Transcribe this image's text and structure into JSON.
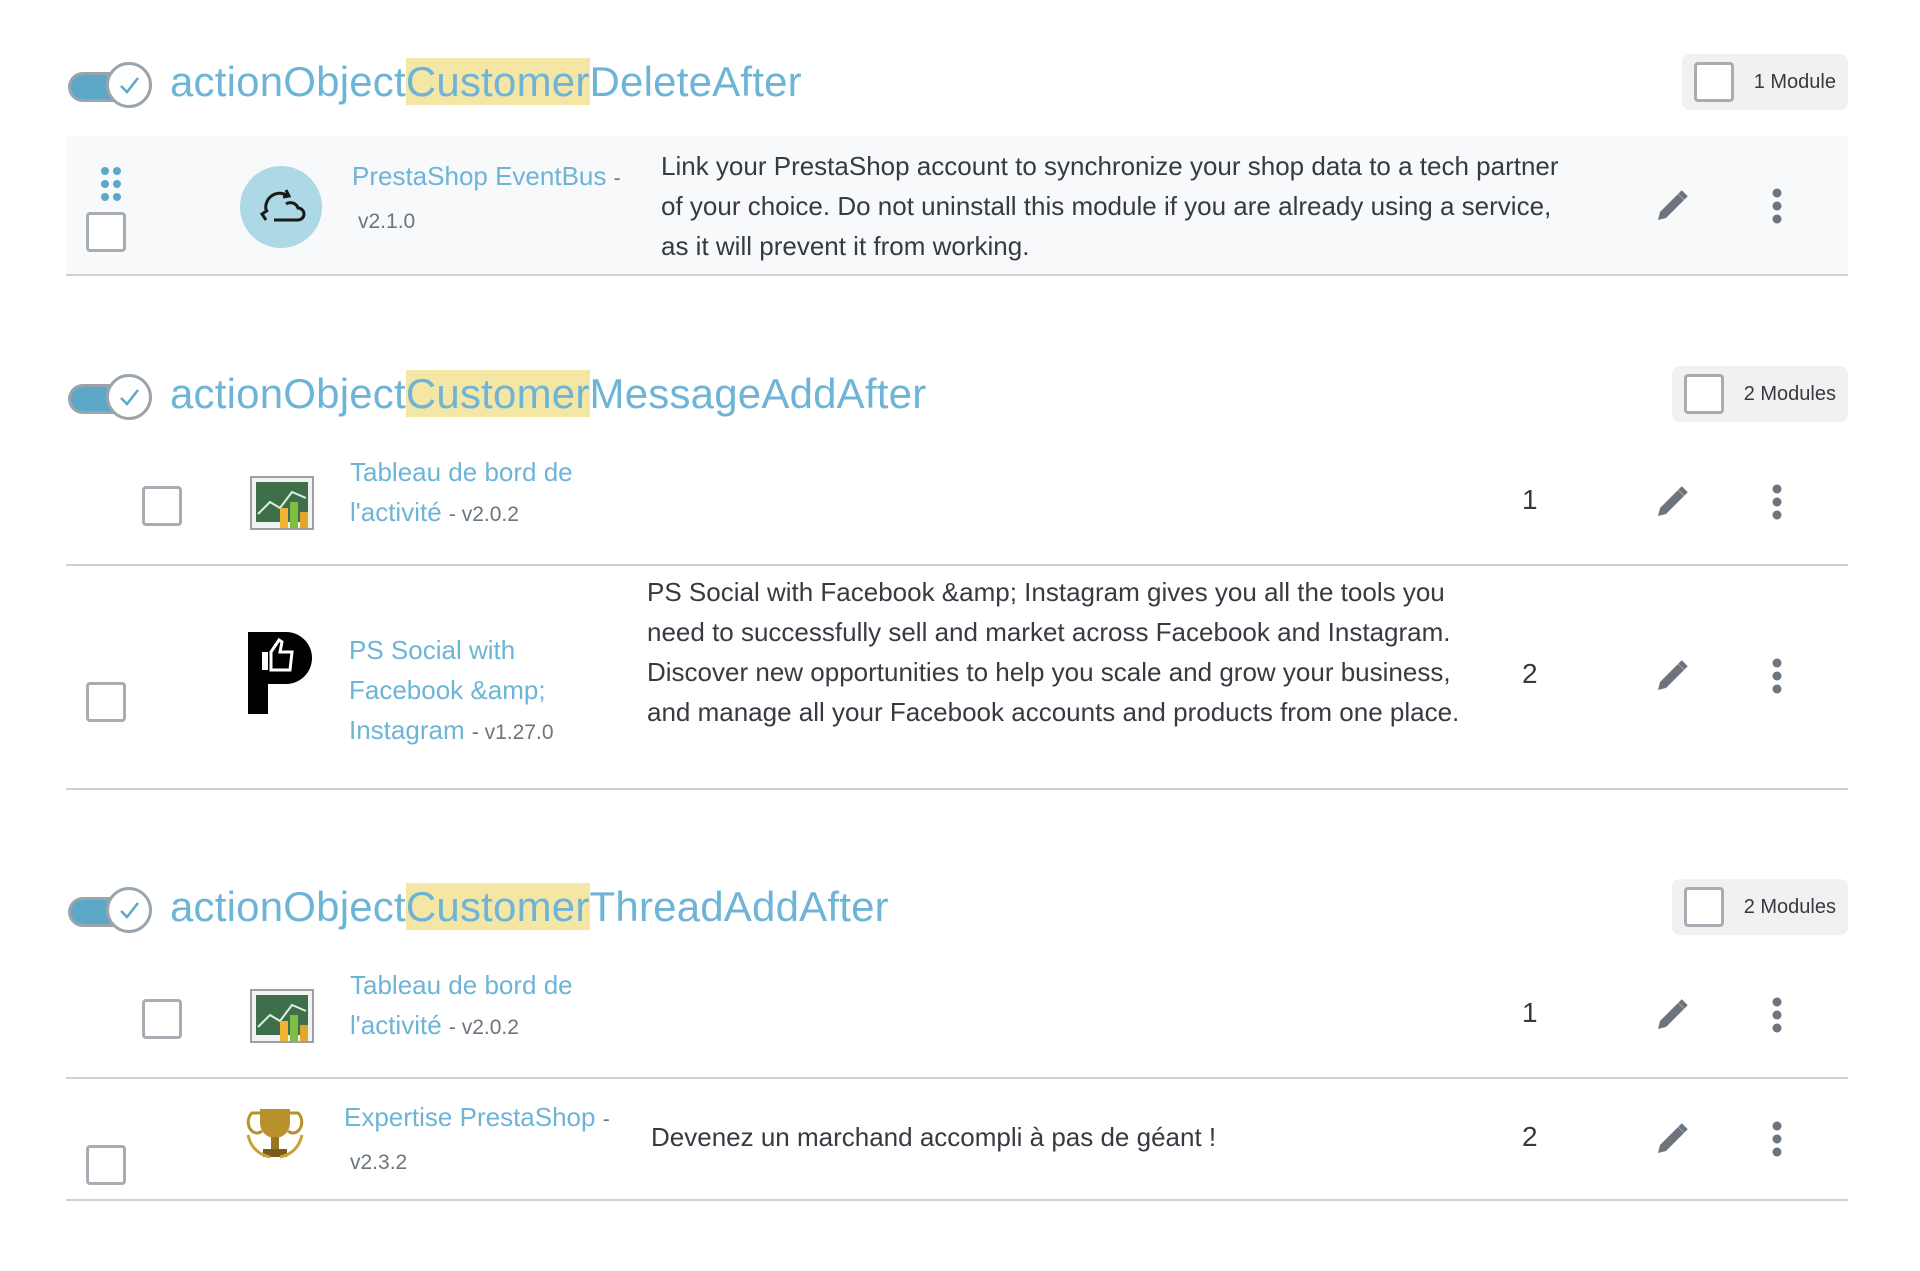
{
  "hooks": [
    {
      "name_prefix": "actionObject",
      "name_highlight": "Customer",
      "name_suffix": "DeleteAfter",
      "module_count": "1 Module",
      "modules": [
        {
          "name": "PrestaShop EventBus",
          "sep": "-",
          "version": "v2.1.0",
          "description": "Link your PrestaShop account to synchronize your shop data to a tech partner of your choice. Do not uninstall this module if you are already using a service, as it will prevent it from working.",
          "icon": "sync-cloud-icon"
        }
      ]
    },
    {
      "name_prefix": "actionObject",
      "name_highlight": "Customer",
      "name_suffix": "MessageAddAfter",
      "module_count": "2 Modules",
      "modules": [
        {
          "name_line1": "Tableau de bord de",
          "name_line2": "l'activité",
          "version": "- v2.0.2",
          "description": "",
          "position": "1",
          "icon": "dashboard-chart-icon"
        },
        {
          "name_line1": "PS Social with",
          "name_line2": "Facebook &amp;",
          "name_line3": "Instagram",
          "version": "- v1.27.0",
          "description": "PS Social with Facebook &amp; Instagram gives you all the tools you need to successfully sell and market across Facebook and Instagram. Discover new opportunities to help you scale and grow your business, and manage all your Facebook accounts and products from one place.",
          "position": "2",
          "icon": "ps-social-thumb-icon"
        }
      ]
    },
    {
      "name_prefix": "actionObject",
      "name_highlight": "Customer",
      "name_suffix": "ThreadAddAfter",
      "module_count": "2 Modules",
      "modules": [
        {
          "name_line1": "Tableau de bord de",
          "name_line2": "l'activité",
          "version": "- v2.0.2",
          "description": "",
          "position": "1",
          "icon": "dashboard-chart-icon"
        },
        {
          "name": "Expertise PrestaShop",
          "sep": "-",
          "version": "v2.3.2",
          "description": "Devenez un marchand accompli à pas de géant !",
          "position": "2",
          "icon": "trophy-icon"
        }
      ]
    }
  ],
  "colors": {
    "link": "#6db4d6",
    "highlight": "#f4e7a5",
    "toggle": "#5da7c9",
    "text": "#363a41"
  }
}
